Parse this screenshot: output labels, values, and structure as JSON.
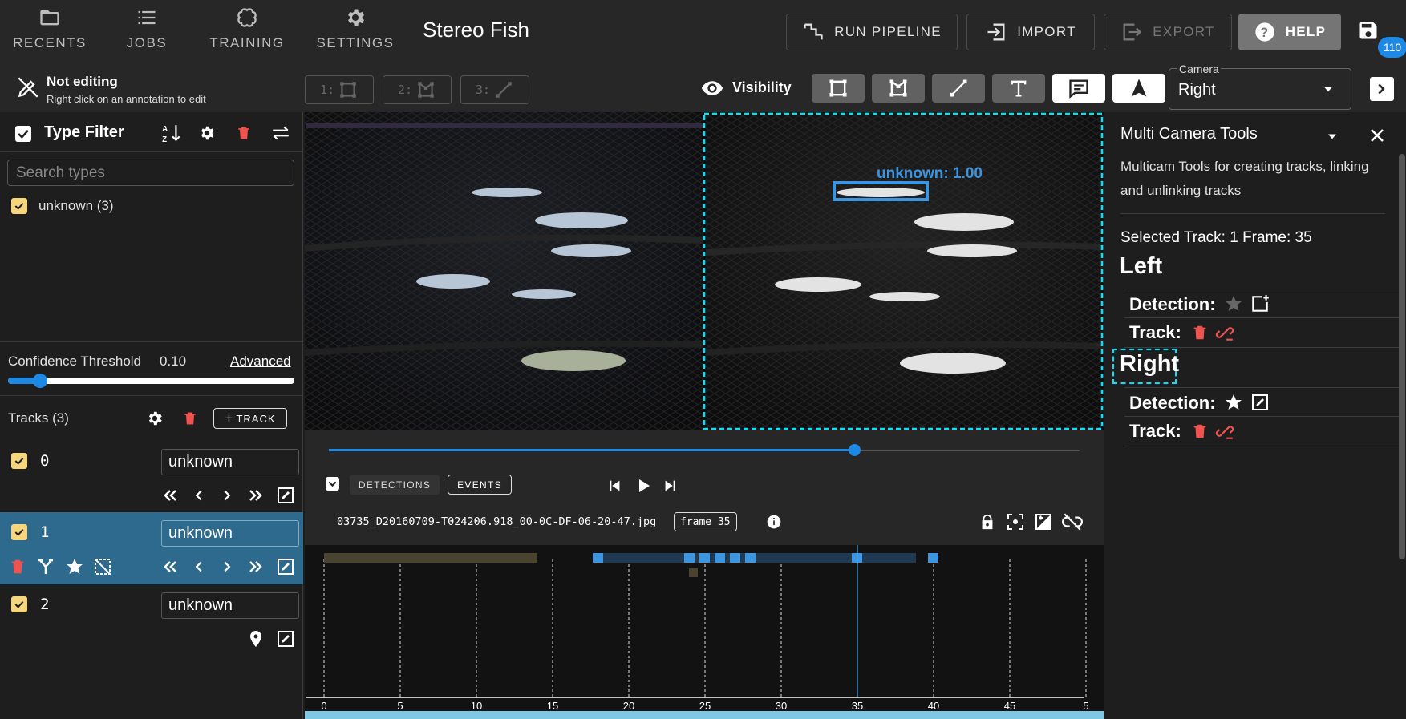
{
  "nav": {
    "recents": "RECENTS",
    "jobs": "JOBS",
    "training": "TRAINING",
    "settings": "SETTINGS",
    "title": "Stereo Fish",
    "run_pipeline": "RUN PIPELINE",
    "import": "IMPORT",
    "export": "EXPORT",
    "help": "HELP",
    "badge": "110"
  },
  "toolbar": {
    "edit_status": "Not editing",
    "edit_hint": "Right click on an annotation to edit",
    "mode1": "1:",
    "mode2": "2:",
    "mode3": "3:",
    "visibility": "Visibility",
    "camera_label": "Camera",
    "camera_value": "Right"
  },
  "type_filter": {
    "title": "Type Filter",
    "search_placeholder": "Search types",
    "types": [
      {
        "label": "unknown (3)"
      }
    ]
  },
  "confidence": {
    "label": "Confidence Threshold",
    "value": "0.10",
    "value_fraction": 0.1,
    "advanced": "Advanced"
  },
  "tracks": {
    "header": "Tracks (3)",
    "add_label": "TRACK",
    "items": [
      {
        "id": "0",
        "type": "unknown",
        "selected": false
      },
      {
        "id": "1",
        "type": "unknown",
        "selected": true
      },
      {
        "id": "2",
        "type": "unknown",
        "selected": false
      }
    ]
  },
  "video": {
    "annotation_label": "unknown: 1.00"
  },
  "playback": {
    "progress_fraction": 0.7,
    "detections_label": "DETECTIONS",
    "events_label": "EVENTS",
    "filename": "03735_D20160709-T024206.918_00-0C-DF-06-20-47.jpg",
    "frame_label": "frame 35"
  },
  "timeline": {
    "ticks": [
      "0",
      "5",
      "10",
      "15",
      "20",
      "25",
      "30",
      "35",
      "40",
      "45",
      "5"
    ],
    "current_frame": 35
  },
  "multicam": {
    "title": "Multi Camera Tools",
    "description": "Multicam Tools for creating tracks, linking and unlinking tracks",
    "selected": "Selected Track: 1 Frame: 35",
    "left_heading": "Left",
    "right_heading": "Right",
    "detection_label": "Detection:",
    "track_label": "Track:"
  },
  "colors": {
    "accent": "#1e88e5",
    "selected_row": "#2d6a8e",
    "checkbox": "#f6d57d",
    "delete": "#ef5350",
    "selection_outline": "#00e5ff",
    "annotation": "#3d95e0"
  }
}
